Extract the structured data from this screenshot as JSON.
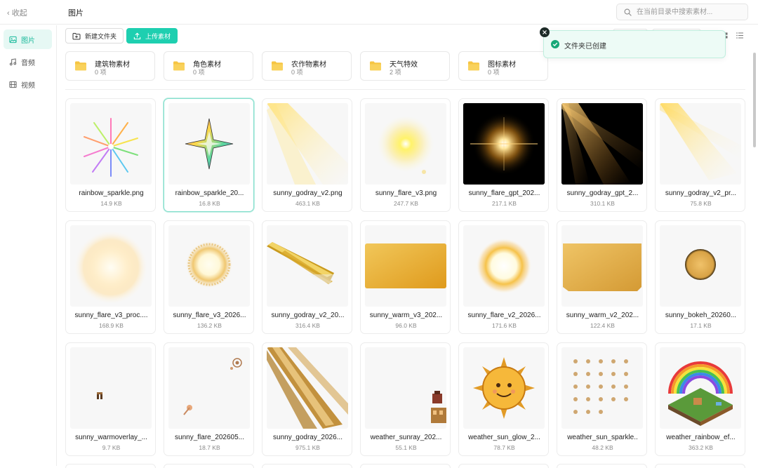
{
  "header": {
    "back_label": "‹ 收起",
    "page_title": "图片",
    "search_placeholder": "在当前目录中搜索素材..."
  },
  "sidebar": {
    "items": [
      {
        "label": "图片",
        "icon": "image-icon",
        "active": true
      },
      {
        "label": "音频",
        "icon": "music-icon",
        "active": false
      },
      {
        "label": "视频",
        "icon": "film-icon",
        "active": false
      }
    ]
  },
  "toolbar": {
    "new_folder_label": "新建文件夹",
    "upload_label": "上传素材"
  },
  "toast": {
    "message": "文件夹已创建"
  },
  "folders": [
    {
      "name": "建筑物素材",
      "count": "0 项"
    },
    {
      "name": "角色素材",
      "count": "0 项"
    },
    {
      "name": "农作物素材",
      "count": "0 项"
    },
    {
      "name": "天气特效",
      "count": "2 项"
    },
    {
      "name": "图标素材",
      "count": "0 项"
    }
  ],
  "files": [
    {
      "name": "rainbow_sparkle.png",
      "size": "14.9 KB"
    },
    {
      "name": "rainbow_sparkle_20...",
      "size": "16.8 KB"
    },
    {
      "name": "sunny_godray_v2.png",
      "size": "463.1 KB"
    },
    {
      "name": "sunny_flare_v3.png",
      "size": "247.7 KB"
    },
    {
      "name": "sunny_flare_gpt_202...",
      "size": "217.1 KB"
    },
    {
      "name": "sunny_godray_gpt_2...",
      "size": "310.1 KB"
    },
    {
      "name": "sunny_godray_v2_pr...",
      "size": "75.8 KB"
    },
    {
      "name": "sunny_flare_v3_proc....",
      "size": "168.9 KB"
    },
    {
      "name": "sunny_flare_v3_2026...",
      "size": "136.2 KB"
    },
    {
      "name": "sunny_godray_v2_20...",
      "size": "316.4 KB"
    },
    {
      "name": "sunny_warm_v3_202...",
      "size": "96.0 KB"
    },
    {
      "name": "sunny_flare_v2_2026...",
      "size": "171.6 KB"
    },
    {
      "name": "sunny_warm_v2_202...",
      "size": "122.4 KB"
    },
    {
      "name": "sunny_bokeh_20260...",
      "size": "17.1 KB"
    },
    {
      "name": "sunny_warmoverlay_...",
      "size": "9.7 KB"
    },
    {
      "name": "sunny_flare_202605...",
      "size": "18.7 KB"
    },
    {
      "name": "sunny_godray_2026...",
      "size": "975.1 KB"
    },
    {
      "name": "weather_sunray_202...",
      "size": "55.1 KB"
    },
    {
      "name": "weather_sun_glow_2...",
      "size": "78.7 KB"
    },
    {
      "name": "weather_sun_sparkle..",
      "size": "48.2 KB"
    },
    {
      "name": "weather_rainbow_ef...",
      "size": "363.2 KB"
    }
  ],
  "colors": {
    "accent": "#1ecfb0",
    "active_bg": "#e6f8f4",
    "folder": "#f6c543",
    "success": "#17a878"
  }
}
